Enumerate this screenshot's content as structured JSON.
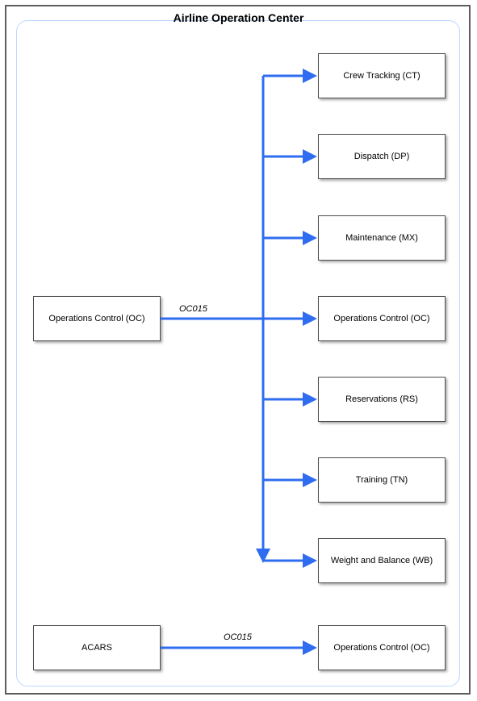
{
  "diagram": {
    "title": "Airline Operation Center",
    "source1": "Operations Control (OC)",
    "source2": "ACARS",
    "edge1_label": "OC015",
    "edge2_label": "OC015",
    "targets": {
      "ct": "Crew Tracking (CT)",
      "dp": "Dispatch (DP)",
      "mx": "Maintenance (MX)",
      "oc": "Operations Control (OC)",
      "rs": "Reservations (RS)",
      "tn": "Training (TN)",
      "wb": "Weight and Balance (WB)",
      "oc2": "Operations Control (OC)"
    }
  }
}
